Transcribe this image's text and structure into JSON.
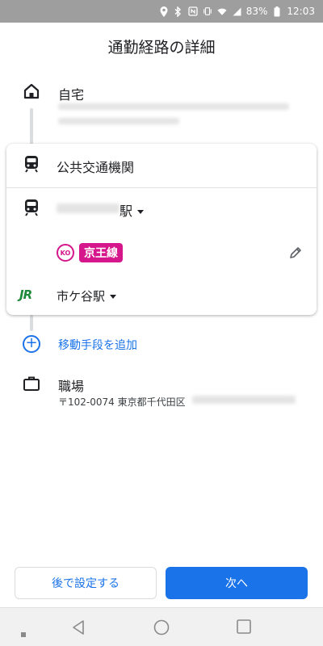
{
  "status_bar": {
    "battery": "83%",
    "time": "12:03"
  },
  "page": {
    "title": "通勤経路の詳細"
  },
  "route": {
    "home_label": "自宅",
    "transit_label": "公共交通機関",
    "origin_station_suffix": "駅",
    "line_code": "KO",
    "line_name": "京王線",
    "destination_station": "市ケ谷駅",
    "jr_logo": "JR",
    "add_mode_label": "移動手段を追加",
    "work_label": "職場",
    "work_address": "〒102-0074 東京都千代田区"
  },
  "buttons": {
    "later_label": "後で設定する",
    "next_label": "次へ"
  },
  "colors": {
    "accent": "#1a73e8",
    "keio": "#d6168b",
    "jr": "#1f8a3b"
  }
}
